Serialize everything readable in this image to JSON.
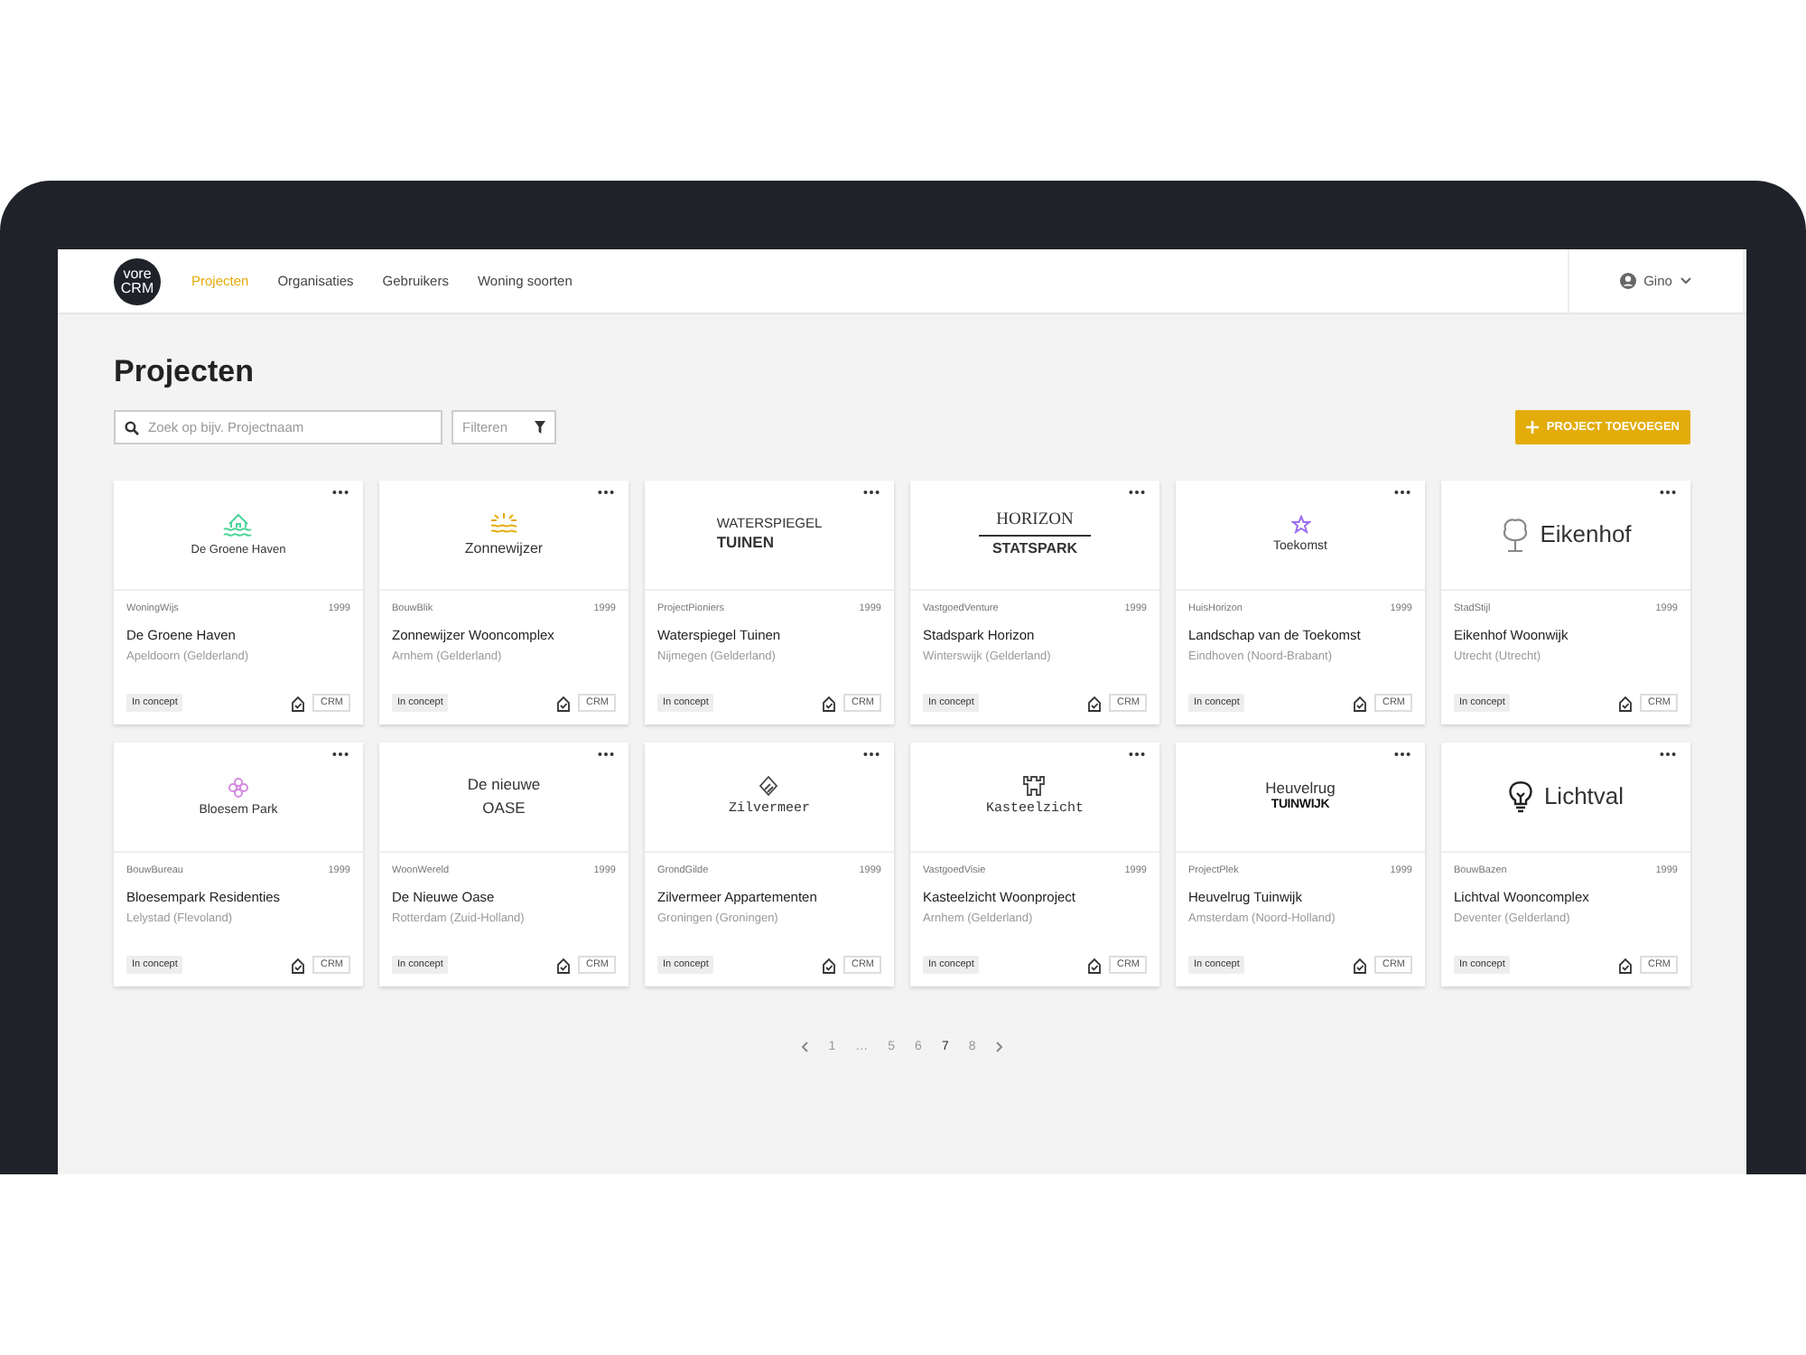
{
  "brand": {
    "lines": [
      "vore",
      "CRM"
    ]
  },
  "nav": [
    {
      "label": "Projecten",
      "selected": true
    },
    {
      "label": "Organisaties",
      "selected": false
    },
    {
      "label": "Gebruikers",
      "selected": false
    },
    {
      "label": "Woning soorten",
      "selected": false
    }
  ],
  "user_menu": {
    "label": "Gino"
  },
  "page_title": "Projecten",
  "search": {
    "placeholder": "Zoek op bijv. Projectnaam"
  },
  "filter": {
    "label": "Filteren"
  },
  "add_button": {
    "label": "PROJECT TOEVOEGEN"
  },
  "projects": [
    {
      "logo": {
        "kind": "house",
        "lines": [
          "De Groene Haven"
        ]
      },
      "company": "WoningWijs",
      "year": "1999",
      "name": "De Groene Haven",
      "location": "Apeldoorn (Gelderland)",
      "status": "In concept",
      "source": "CRM"
    },
    {
      "logo": {
        "kind": "sun",
        "lines": [
          "Zonnewijzer"
        ]
      },
      "company": "BouwBlik",
      "year": "1999",
      "name": "Zonnewijzer Wooncomplex",
      "location": "Arnhem (Gelderland)",
      "status": "In concept",
      "source": "CRM"
    },
    {
      "logo": {
        "kind": "plain-stacked",
        "lines": [
          "WATERSPIEGEL",
          "TUINEN"
        ]
      },
      "company": "ProjectPioniers",
      "year": "1999",
      "name": "Waterspiegel Tuinen",
      "location": "Nijmegen (Gelderland)",
      "status": "In concept",
      "source": "CRM"
    },
    {
      "logo": {
        "kind": "serif-rule",
        "lines": [
          "HORIZON",
          "STATSPARK"
        ]
      },
      "company": "VastgoedVenture",
      "year": "1999",
      "name": "Stadspark Horizon",
      "location": "Winterswijk (Gelderland)",
      "status": "In concept",
      "source": "CRM"
    },
    {
      "logo": {
        "kind": "star",
        "lines": [
          "Toekomst"
        ]
      },
      "company": "HuisHorizon",
      "year": "1999",
      "name": "Landschap van de Toekomst",
      "location": "Eindhoven (Noord-Brabant)",
      "status": "In concept",
      "source": "CRM"
    },
    {
      "logo": {
        "kind": "tree",
        "lines": [
          "Eikenhof"
        ]
      },
      "company": "StadStijl",
      "year": "1999",
      "name": "Eikenhof Woonwijk",
      "location": "Utrecht (Utrecht)",
      "status": "In concept",
      "source": "CRM"
    },
    {
      "logo": {
        "kind": "flower",
        "lines": [
          "Bloesem Park"
        ]
      },
      "company": "BouwBureau",
      "year": "1999",
      "name": "Bloesempark Residenties",
      "location": "Lelystad (Flevoland)",
      "status": "In concept",
      "source": "CRM"
    },
    {
      "logo": {
        "kind": "thin-stacked",
        "lines": [
          "De nieuwe",
          "OASE"
        ]
      },
      "company": "WoonWereld",
      "year": "1999",
      "name": "De Nieuwe Oase",
      "location": "Rotterdam (Zuid-Holland)",
      "status": "In concept",
      "source": "CRM"
    },
    {
      "logo": {
        "kind": "lozenge",
        "lines": [
          "Zilvermeer"
        ]
      },
      "company": "GrondGilde",
      "year": "1999",
      "name": "Zilvermeer Appartementen",
      "location": "Groningen (Groningen)",
      "status": "In concept",
      "source": "CRM"
    },
    {
      "logo": {
        "kind": "castle",
        "lines": [
          "Kasteelzicht"
        ]
      },
      "company": "VastgoedVisie",
      "year": "1999",
      "name": "Kasteelzicht Woonproject",
      "location": "Arnhem (Gelderland)",
      "status": "In concept",
      "source": "CRM"
    },
    {
      "logo": {
        "kind": "heavy-stacked",
        "lines": [
          "Heuvelrug",
          "TUINWIJK"
        ]
      },
      "company": "ProjectPlek",
      "year": "1999",
      "name": "Heuvelrug Tuinwijk",
      "location": "Amsterdam (Noord-Holland)",
      "status": "In concept",
      "source": "CRM"
    },
    {
      "logo": {
        "kind": "bulb",
        "lines": [
          "Lichtval"
        ]
      },
      "company": "BouwBazen",
      "year": "1999",
      "name": "Lichtval Wooncomplex",
      "location": "Deventer (Gelderland)",
      "status": "In concept",
      "source": "CRM"
    }
  ],
  "pagination": [
    {
      "label": "1",
      "selected": false
    },
    {
      "label": "…",
      "selected": false
    },
    {
      "label": "5",
      "selected": false
    },
    {
      "label": "6",
      "selected": false
    },
    {
      "label": "7",
      "selected": true
    },
    {
      "label": "8",
      "selected": false
    }
  ]
}
